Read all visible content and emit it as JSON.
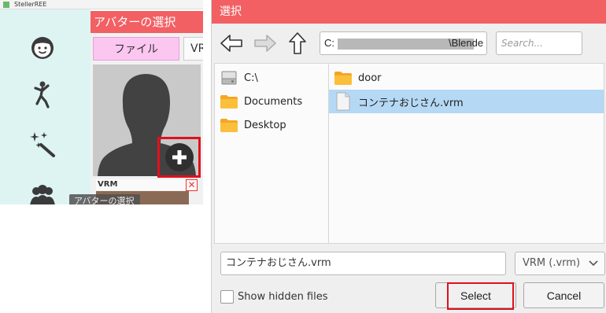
{
  "left_app": {
    "window_title": "StellerREE",
    "sidebar_icons": [
      "face-icon",
      "pose-icon",
      "effects-icon",
      "group-icon"
    ],
    "avatar_select": {
      "header": "アバターの選択",
      "tab_file": "ファイル",
      "tab_vrm": "VR",
      "vrm_badge": "VRM",
      "close_glyph": "✕",
      "tooltip": "アバターの選択"
    },
    "accent_color": "#f26063",
    "highlight_color": "#e0101d"
  },
  "dialog": {
    "title": "選択",
    "toolbar": {
      "back_icon": "arrow-left-icon",
      "forward_icon": "arrow-right-icon",
      "up_icon": "arrow-up-icon",
      "path_prefix": "C:",
      "path_suffix": "\\Blende",
      "search_placeholder": "Search..."
    },
    "locations": [
      {
        "label": "C:\\",
        "icon": "drive-icon"
      },
      {
        "label": "Documents",
        "icon": "folder-icon"
      },
      {
        "label": "Desktop",
        "icon": "folder-icon"
      }
    ],
    "files": [
      {
        "label": "door",
        "icon": "folder-icon",
        "selected": false
      },
      {
        "label": "コンテナおじさん.vrm",
        "icon": "file-icon",
        "selected": true
      }
    ],
    "filename_value": "コンテナおじさん.vrm",
    "filetype_value": "VRM (.vrm)",
    "show_hidden_label": "Show hidden files",
    "select_label": "Select",
    "cancel_label": "Cancel",
    "selection_color": "#b5d8f5"
  }
}
